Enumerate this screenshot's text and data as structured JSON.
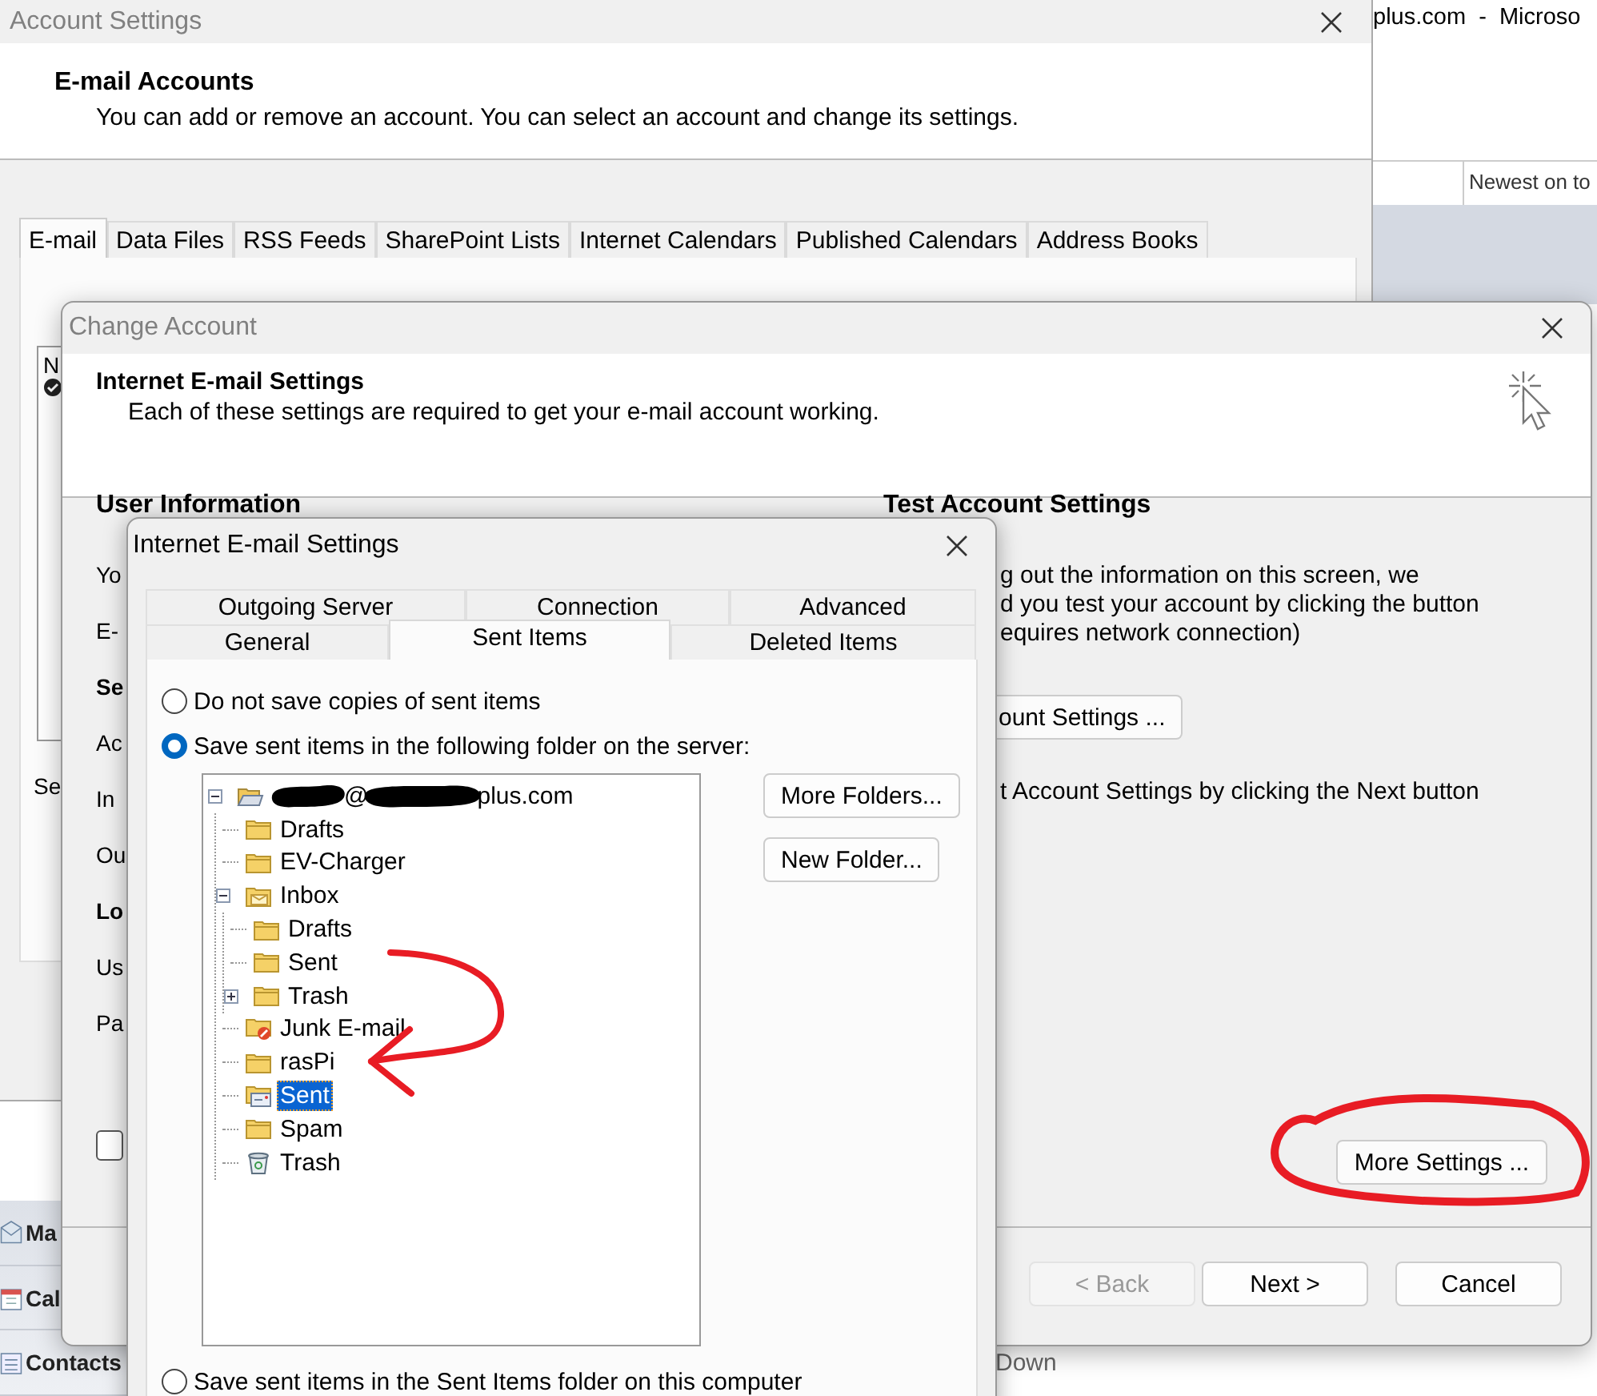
{
  "outlook": {
    "title": "plus.com  -  Microso",
    "sort_label": "Newest on to",
    "nav": [
      {
        "label": "Ma",
        "kind": "mail"
      },
      {
        "label": "Cal",
        "kind": "calendar"
      },
      {
        "label": "Contacts",
        "kind": "contacts"
      }
    ],
    "footer": "Down"
  },
  "account_settings": {
    "title": "Account Settings",
    "heading": "E-mail Accounts",
    "description": "You can add or remove an account. You can select an account and change its settings.",
    "tabs": [
      {
        "label": "E-mail",
        "selected": true
      },
      {
        "label": "Data Files",
        "selected": false
      },
      {
        "label": "RSS Feeds",
        "selected": false
      },
      {
        "label": "SharePoint Lists",
        "selected": false
      },
      {
        "label": "Internet Calendars",
        "selected": false
      },
      {
        "label": "Published Calendars",
        "selected": false
      },
      {
        "label": "Address Books",
        "selected": false
      }
    ],
    "list_header": "N",
    "side_label": "Se"
  },
  "change_account": {
    "title": "Change Account",
    "heading": "Internet E-mail Settings",
    "description": "Each of these settings are required to get your e-mail account working.",
    "user_information": {
      "title": "User Information",
      "labels": [
        {
          "text": "Yo",
          "kind": "label"
        },
        {
          "text": "E-",
          "kind": "label"
        },
        {
          "text": "Se",
          "kind": "heading"
        },
        {
          "text": "Ac",
          "kind": "label"
        },
        {
          "text": "In",
          "kind": "label"
        },
        {
          "text": "Ou",
          "kind": "label"
        },
        {
          "text": "Lo",
          "kind": "heading"
        },
        {
          "text": "Us",
          "kind": "label"
        },
        {
          "text": "Pa",
          "kind": "label"
        }
      ],
      "checkbox": {
        "checked": false
      }
    },
    "test_account": {
      "title": "Test Account Settings",
      "lines": [
        "g out the information on this screen, we",
        "d you test your account by clicking the button",
        "equires network connection)"
      ],
      "button": "ount Settings ...",
      "note": "t Account Settings by clicking the Next button"
    },
    "more_settings_button": "More Settings ...",
    "buttons": [
      {
        "label": "< Back",
        "disabled": true
      },
      {
        "label": "Next >",
        "disabled": false
      },
      {
        "label": "Cancel",
        "disabled": false
      }
    ]
  },
  "mail_settings_dialog": {
    "title": "Internet E-mail Settings",
    "tab_rows": [
      [
        {
          "label": "Outgoing Server",
          "selected": false
        },
        {
          "label": "Connection",
          "selected": false
        },
        {
          "label": "Advanced",
          "selected": false
        }
      ],
      [
        {
          "label": "General",
          "selected": false
        },
        {
          "label": "Sent Items",
          "selected": true
        },
        {
          "label": "Deleted Items",
          "selected": false
        }
      ]
    ],
    "options": [
      {
        "label": "Do not save copies of sent items",
        "selected": false
      },
      {
        "label": "Save sent items in the following folder on the server:",
        "selected": true
      }
    ],
    "folder_tree": {
      "at": "@",
      "label": "plus.com",
      "kind": "account",
      "expanded": true,
      "selected": false,
      "children": [
        {
          "label": "Drafts",
          "kind": "folder",
          "selected": false
        },
        {
          "label": "EV-Charger",
          "kind": "folder",
          "selected": false
        },
        {
          "label": "Inbox",
          "kind": "inbox",
          "expanded": true,
          "selected": false,
          "children": [
            {
              "label": "Drafts",
              "kind": "folder",
              "selected": false
            },
            {
              "label": "Sent",
              "kind": "folder",
              "selected": false
            },
            {
              "label": "Trash",
              "kind": "folder",
              "expanded": false,
              "selected": false
            }
          ]
        },
        {
          "label": "Junk E-mail",
          "kind": "junk",
          "selected": false
        },
        {
          "label": "rasPi",
          "kind": "folder",
          "selected": false
        },
        {
          "label": "Sent",
          "kind": "sent",
          "selected": true
        },
        {
          "label": "Spam",
          "kind": "folder",
          "selected": false
        },
        {
          "label": "Trash",
          "kind": "trash",
          "selected": false
        }
      ]
    },
    "folder_buttons": [
      "More Folders...",
      "New Folder..."
    ],
    "local_option": {
      "label": "Save sent items in the Sent Items folder on this computer",
      "selected": false
    }
  }
}
